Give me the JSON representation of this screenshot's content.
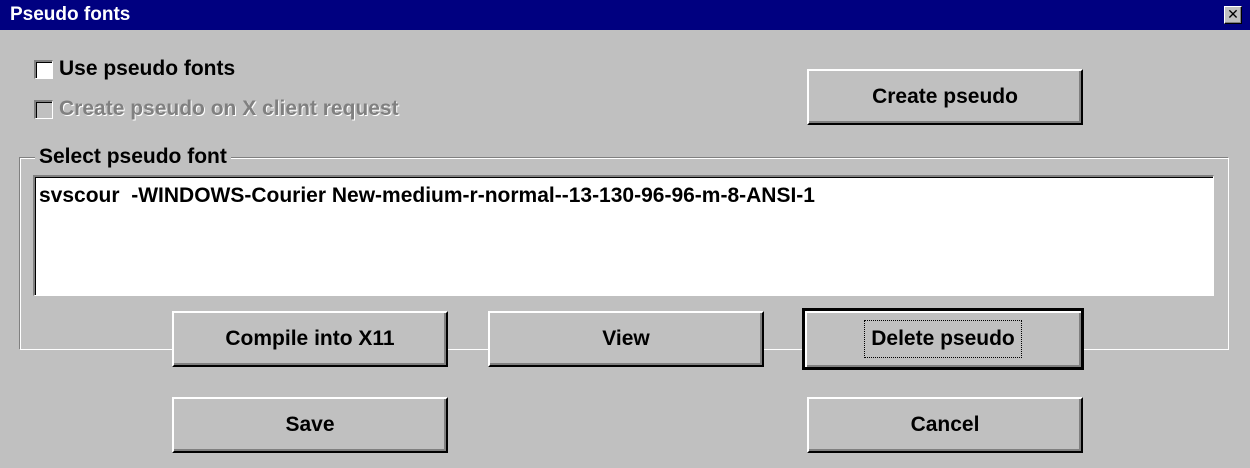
{
  "window": {
    "title": "Pseudo fonts",
    "close_glyph": "✕"
  },
  "options": {
    "use_pseudo_fonts": {
      "label": "Use pseudo fonts",
      "checked": false,
      "enabled": true
    },
    "create_on_request": {
      "label": "Create pseudo on X client request",
      "checked": false,
      "enabled": false
    }
  },
  "buttons": {
    "create_pseudo": "Create pseudo",
    "compile_into_x11": "Compile into X11",
    "view": "View",
    "delete_pseudo": "Delete pseudo",
    "save": "Save",
    "cancel": "Cancel"
  },
  "select_group": {
    "label": "Select pseudo font",
    "items": [
      "svscour  -WINDOWS-Courier New-medium-r-normal--13-130-96-96-m-8-ANSI-1"
    ]
  },
  "colors": {
    "titlebar": "#000080",
    "face": "#c0c0c0",
    "disabled_text": "#808080"
  }
}
